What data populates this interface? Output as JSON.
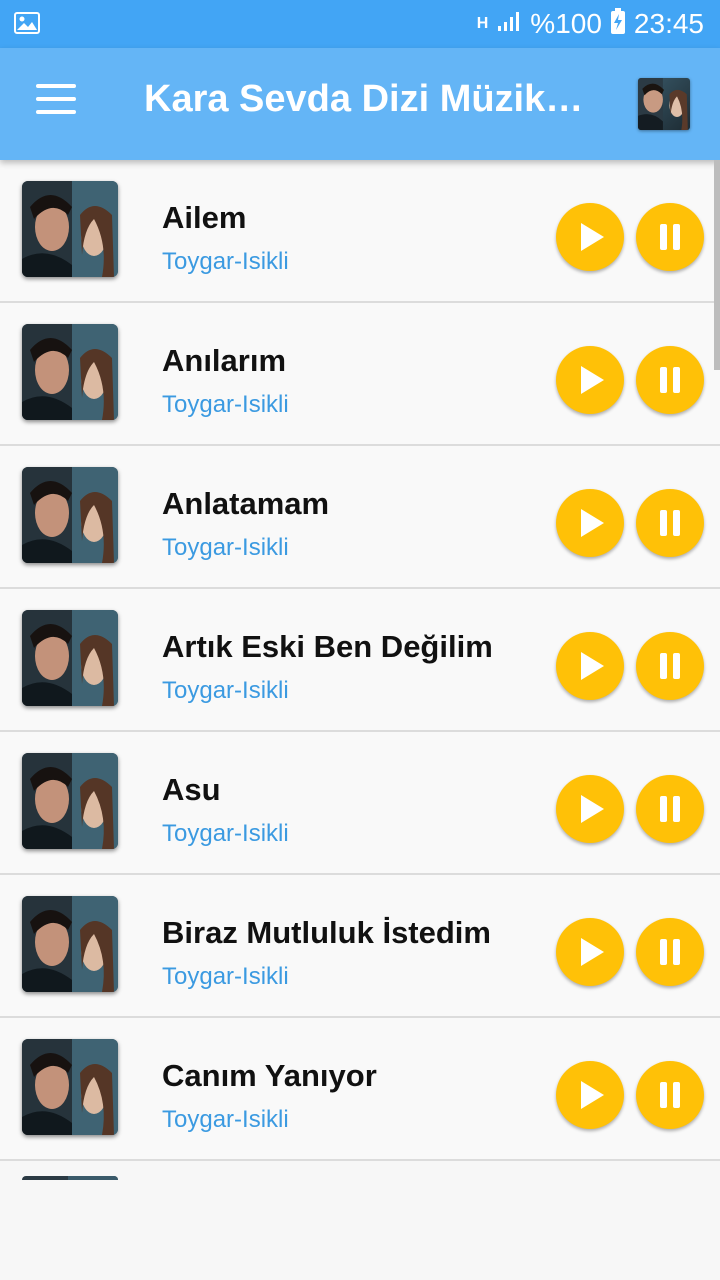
{
  "status_bar": {
    "network": "H",
    "battery_percent": "%100",
    "time": "23:45"
  },
  "app_bar": {
    "title": "Kara Sevda Dizi Müzikl…"
  },
  "songs": [
    {
      "title": "Ailem",
      "artist": "Toygar-Isikli"
    },
    {
      "title": "Anılarım",
      "artist": "Toygar-Isikli"
    },
    {
      "title": "Anlatamam",
      "artist": "Toygar-Isikli"
    },
    {
      "title": "Artık Eski Ben Değilim",
      "artist": "Toygar-Isikli"
    },
    {
      "title": "Asu",
      "artist": "Toygar-Isikli"
    },
    {
      "title": "Biraz Mutluluk İstedim",
      "artist": "Toygar-Isikli"
    },
    {
      "title": "Canım Yanıyor",
      "artist": "Toygar-Isikli"
    }
  ],
  "colors": {
    "status_bar": "#42a5f5",
    "app_bar": "#64b5f6",
    "button": "#ffc107",
    "artist_text": "#3b9ae1"
  },
  "icons": {
    "menu": "hamburger-menu-icon",
    "play": "play-icon",
    "pause": "pause-icon"
  }
}
